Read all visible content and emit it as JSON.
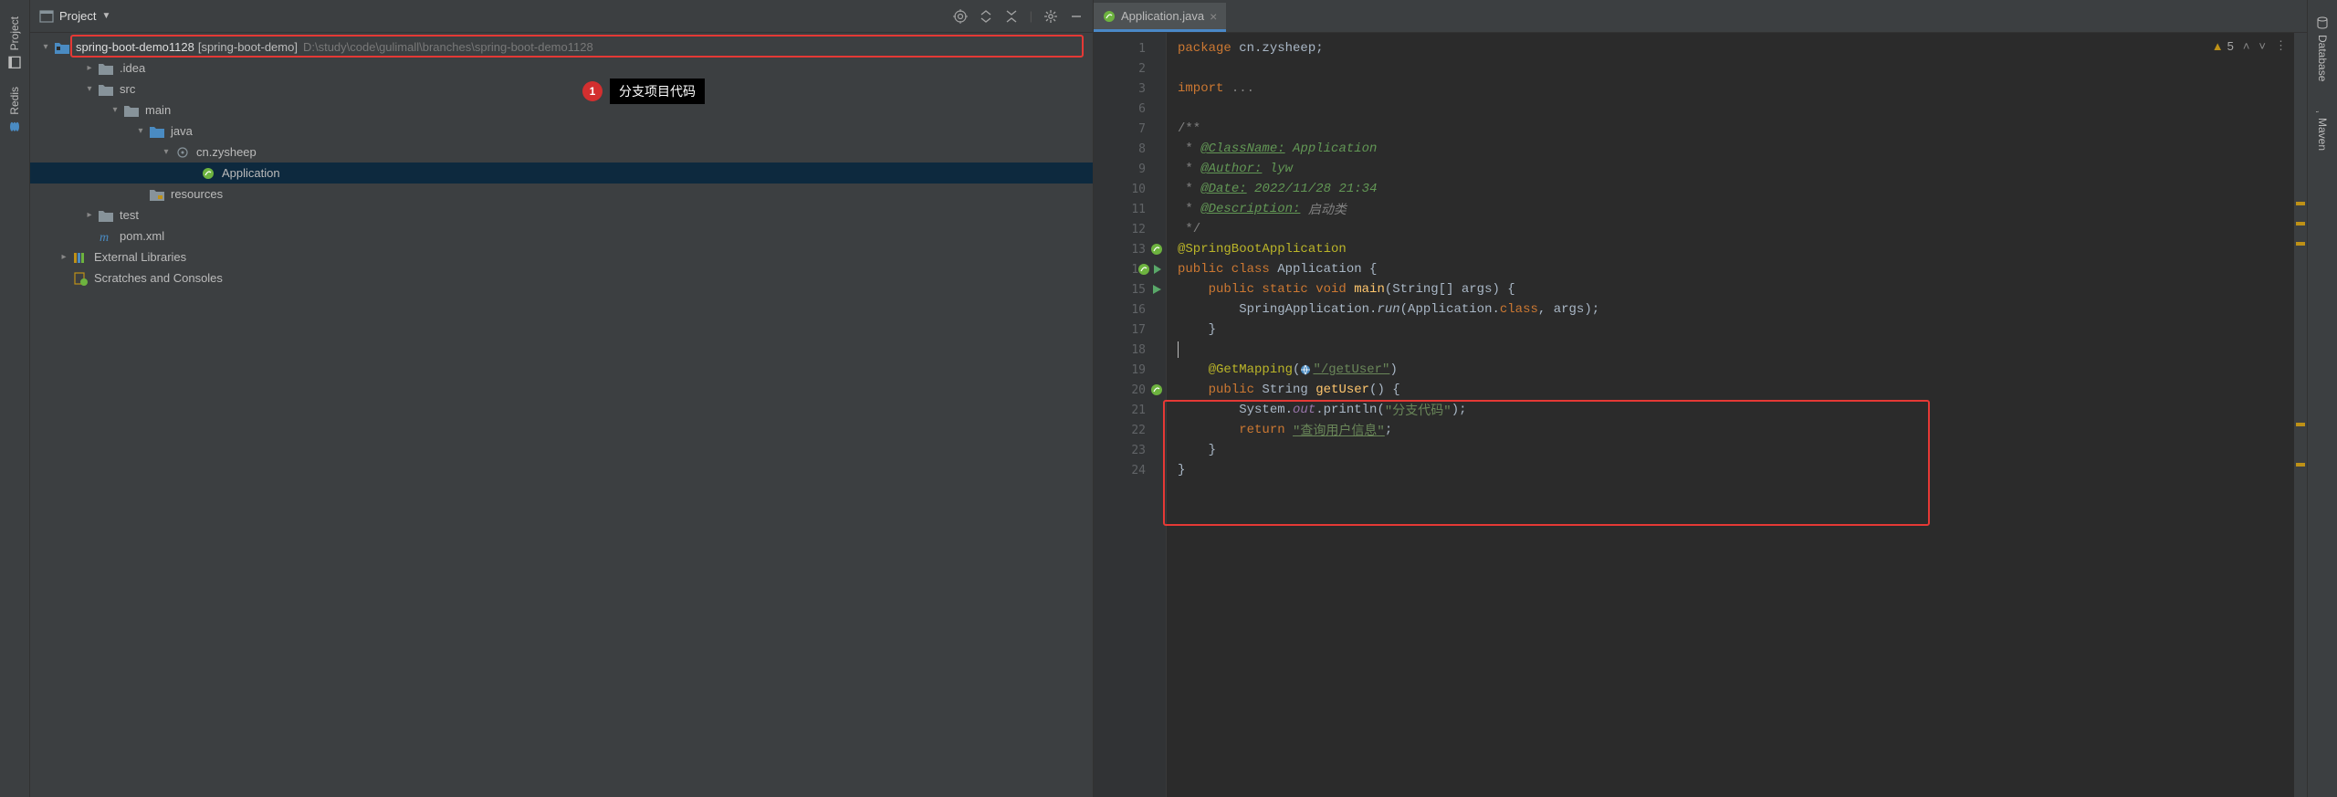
{
  "left_tabs": [
    "Project",
    "Redis"
  ],
  "right_tabs": [
    "Database",
    "Maven"
  ],
  "project_panel": {
    "title": "Project",
    "toolbar_icons": [
      "target-icon",
      "expand-all-icon",
      "collapse-all-icon",
      "gear-icon",
      "minimize-icon"
    ]
  },
  "tree": {
    "root": {
      "name": "spring-boot-demo1128",
      "module": "[spring-boot-demo]",
      "path": "D:\\study\\code\\gulimall\\branches\\spring-boot-demo1128"
    },
    "nodes": [
      {
        "indent": 1,
        "chev": "right",
        "icon": "folder",
        "label": ".idea"
      },
      {
        "indent": 1,
        "chev": "down",
        "icon": "folder-src",
        "label": "src"
      },
      {
        "indent": 2,
        "chev": "down",
        "icon": "folder",
        "label": "main"
      },
      {
        "indent": 3,
        "chev": "down",
        "icon": "folder-java",
        "label": "java"
      },
      {
        "indent": 4,
        "chev": "down",
        "icon": "package",
        "label": "cn.zysheep"
      },
      {
        "indent": 5,
        "chev": "",
        "icon": "spring",
        "label": "Application",
        "selected": true
      },
      {
        "indent": 3,
        "chev": "",
        "icon": "folder-res",
        "label": "resources"
      },
      {
        "indent": 1,
        "chev": "right",
        "icon": "folder",
        "label": "test"
      },
      {
        "indent": 1,
        "chev": "",
        "icon": "maven",
        "label": "pom.xml"
      },
      {
        "indent": 0,
        "chev": "right",
        "icon": "library",
        "label": "External Libraries"
      },
      {
        "indent": 0,
        "chev": "",
        "icon": "scratch",
        "label": "Scratches and Consoles"
      }
    ]
  },
  "callout": {
    "num": "1",
    "text": "分支项目代码"
  },
  "editor": {
    "tab": {
      "name": "Application.java"
    },
    "warnings": "5",
    "lines": [
      {
        "n": "1",
        "seg": [
          [
            "kw",
            "package "
          ],
          [
            "ident",
            "cn.zysheep"
          ],
          [
            "ident",
            ";"
          ]
        ]
      },
      {
        "n": "2",
        "seg": []
      },
      {
        "n": "3",
        "seg": [
          [
            "kw",
            "import "
          ],
          [
            "comment",
            "..."
          ]
        ],
        "fold": "plus"
      },
      {
        "n": "6",
        "seg": []
      },
      {
        "n": "7",
        "seg": [
          [
            "comment",
            "/**"
          ]
        ],
        "fold": "minus"
      },
      {
        "n": "8",
        "seg": [
          [
            "comment",
            " * "
          ],
          [
            "doc-tag",
            "@ClassName:"
          ],
          [
            "doc-val-i",
            " Application"
          ]
        ]
      },
      {
        "n": "9",
        "seg": [
          [
            "comment",
            " * "
          ],
          [
            "doc-tag",
            "@Author:"
          ],
          [
            "doc-val-i",
            " lyw"
          ]
        ]
      },
      {
        "n": "10",
        "seg": [
          [
            "comment",
            " * "
          ],
          [
            "doc-tag",
            "@Date:"
          ],
          [
            "doc-val-i",
            " 2022/11/28 21:34"
          ]
        ]
      },
      {
        "n": "11",
        "seg": [
          [
            "comment",
            " * "
          ],
          [
            "doc-tag",
            "@Description:"
          ],
          [
            "doc-val",
            " 启动类"
          ]
        ]
      },
      {
        "n": "12",
        "seg": [
          [
            "comment",
            " */"
          ]
        ]
      },
      {
        "n": "13",
        "seg": [
          [
            "anno",
            "@SpringBootApplication"
          ]
        ],
        "gutter": "spring"
      },
      {
        "n": "14",
        "seg": [
          [
            "kw",
            "public class "
          ],
          [
            "type",
            "Application "
          ],
          [
            "ident",
            "{"
          ]
        ],
        "gutter": "run-spring",
        "fold": "minus"
      },
      {
        "n": "15",
        "seg": [
          [
            "ident",
            "    "
          ],
          [
            "kw",
            "public static void "
          ],
          [
            "method-decl",
            "main"
          ],
          [
            "ident",
            "(String[] "
          ],
          [
            "param",
            "args"
          ],
          [
            "ident",
            ") {"
          ]
        ],
        "gutter": "run",
        "fold": "minus"
      },
      {
        "n": "16",
        "seg": [
          [
            "ident",
            "        SpringApplication."
          ],
          [
            "method-call-i",
            "run"
          ],
          [
            "ident",
            "(Application."
          ],
          [
            "kw",
            "class"
          ],
          [
            "ident",
            ", "
          ],
          [
            "param",
            "args"
          ],
          [
            "ident",
            ");"
          ]
        ]
      },
      {
        "n": "17",
        "seg": [
          [
            "ident",
            "    }"
          ]
        ],
        "fold": "end"
      },
      {
        "n": "18",
        "seg": [],
        "caret": true
      },
      {
        "n": "19",
        "seg": [
          [
            "ident",
            "    "
          ],
          [
            "anno",
            "@GetMapping"
          ],
          [
            "ident",
            "("
          ],
          [
            "anno-icon",
            ""
          ],
          [
            "str-u",
            "\"/getUser\""
          ],
          [
            "ident",
            ")"
          ]
        ]
      },
      {
        "n": "20",
        "seg": [
          [
            "ident",
            "    "
          ],
          [
            "kw",
            "public "
          ],
          [
            "type",
            "String "
          ],
          [
            "method-decl",
            "getUser"
          ],
          [
            "ident",
            "() {"
          ]
        ],
        "gutter": "spring",
        "fold": "minus"
      },
      {
        "n": "21",
        "seg": [
          [
            "ident",
            "        System."
          ],
          [
            "field-i",
            "out"
          ],
          [
            "ident",
            ".println("
          ],
          [
            "str",
            "\"分支代码\""
          ],
          [
            "ident",
            ");"
          ]
        ]
      },
      {
        "n": "22",
        "seg": [
          [
            "ident",
            "        "
          ],
          [
            "kw",
            "return "
          ],
          [
            "str-u",
            "\"查询用户信息\""
          ],
          [
            "ident",
            ";"
          ]
        ]
      },
      {
        "n": "23",
        "seg": [
          [
            "ident",
            "    }"
          ]
        ],
        "fold": "end"
      },
      {
        "n": "24",
        "seg": [
          [
            "ident",
            "}"
          ]
        ]
      }
    ]
  }
}
